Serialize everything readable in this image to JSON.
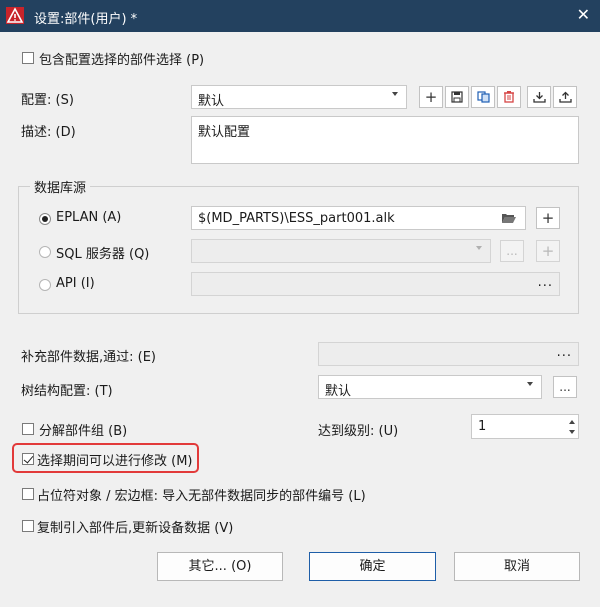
{
  "window": {
    "title": "设置:部件(用户) *",
    "close_glyph": "✕"
  },
  "include_config_selection": {
    "label": "包含配置选择的部件选择 (P)",
    "checked": false
  },
  "config": {
    "label": "配置: (S)",
    "value": "默认",
    "toolbar_icons": [
      "plus-icon",
      "save-icon",
      "copy-icon",
      "delete-icon",
      "import-icon",
      "export-icon"
    ]
  },
  "description": {
    "label": "描述: (D)",
    "value": "默认配置"
  },
  "database_source": {
    "title": "数据库源",
    "eplan": {
      "label": "EPLAN (A)",
      "selected": true,
      "path": "$(MD_PARTS)\\ESS_part001.alk"
    },
    "sql": {
      "label": "SQL 服务器 (Q)",
      "selected": false,
      "dots": "..."
    },
    "api": {
      "label": "API (I)",
      "selected": false,
      "dots": "..."
    }
  },
  "supplement": {
    "label": "补充部件数据,通过: (E)",
    "dots": "..."
  },
  "tree_config": {
    "label": "树结构配置: (T)",
    "value": "默认",
    "dots": "..."
  },
  "decompose_group": {
    "label": "分解部件组 (B)",
    "checked": false
  },
  "level": {
    "label": "达到级别: (U)",
    "value": "1"
  },
  "editable_during_selection": {
    "label": "选择期间可以进行修改 (M)",
    "checked": true
  },
  "placeholder_object": {
    "label": "占位符对象 / 宏边框: 导入无部件数据同步的部件编号 (L)",
    "checked": false
  },
  "update_device_data": {
    "label": "复制引入部件后,更新设备数据 (V)",
    "checked": false
  },
  "buttons": {
    "other": "其它... (O)",
    "ok": "确定",
    "cancel": "取消"
  },
  "colors": {
    "titlebar": "#23415f",
    "highlight": "#e23a3a",
    "delete_icon": "#d64545",
    "copy_icon": "#1f5fb4"
  }
}
